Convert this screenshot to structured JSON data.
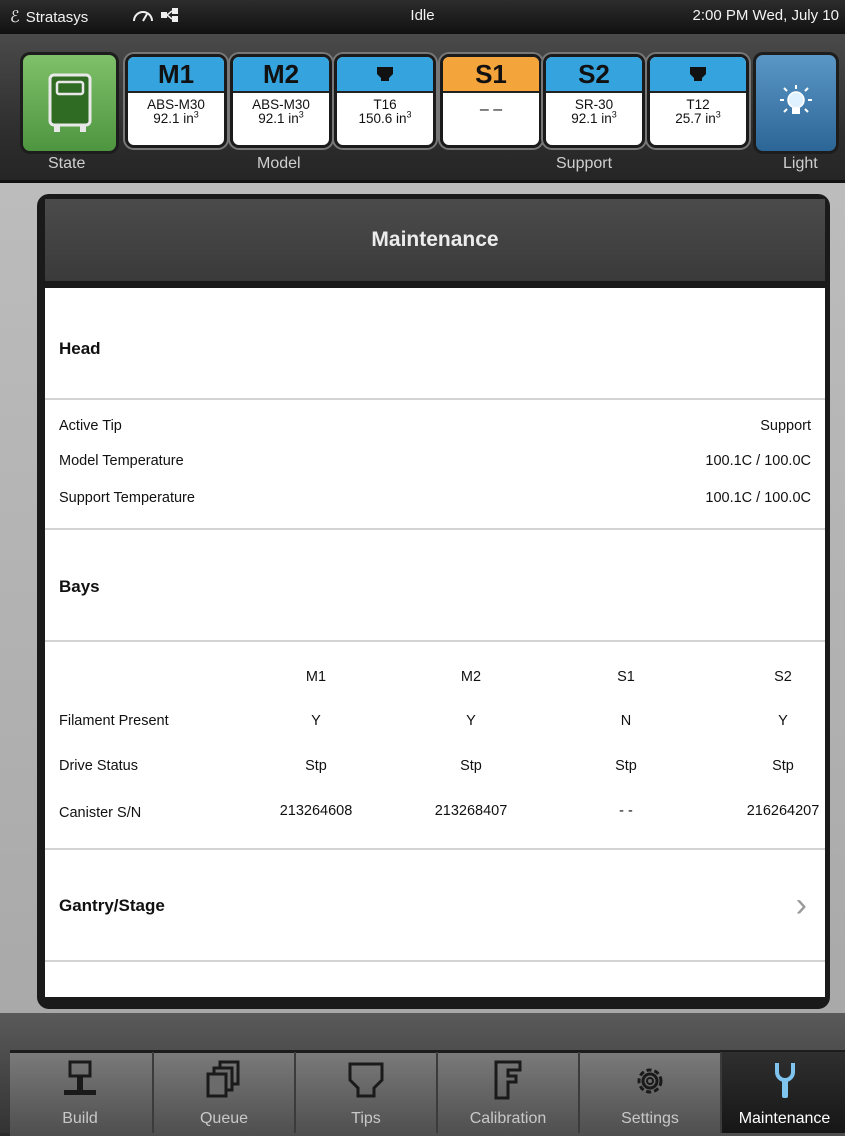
{
  "status_bar": {
    "brand": "Stratasys",
    "state": "Idle",
    "clock": "2:00 PM Wed, July 10"
  },
  "header": {
    "state_label": "State",
    "model_label": "Model",
    "support_label": "Support",
    "light_label": "Light",
    "bays": [
      {
        "id": "M1",
        "line1": "ABS-M30",
        "line2": "92.1 in",
        "sup": "3",
        "color": "#35a3de"
      },
      {
        "id": "M2",
        "line1": "ABS-M30",
        "line2": "92.1 in",
        "sup": "3",
        "color": "#35a3de"
      },
      {
        "id": "tip-model",
        "line1": "T16",
        "line2": "150.6 in",
        "sup": "3",
        "color": "#35a3de",
        "icon": "tip-icon"
      },
      {
        "id": "S1",
        "line1": "– –",
        "line2": "",
        "sup": "",
        "color": "#f3a43a"
      },
      {
        "id": "S2",
        "line1": "SR-30",
        "line2": "92.1 in",
        "sup": "3",
        "color": "#35a3de"
      },
      {
        "id": "tip-support",
        "line1": "T12",
        "line2": "25.7 in",
        "sup": "3",
        "color": "#35a3de",
        "icon": "tip-icon"
      }
    ]
  },
  "page": {
    "title": "Maintenance"
  },
  "head": {
    "title": "Head",
    "rows": [
      {
        "label": "Active Tip",
        "value": "Support"
      },
      {
        "label": "Model Temperature",
        "value": "100.1C / 100.0C"
      },
      {
        "label": "Support Temperature",
        "value": "100.1C / 100.0C"
      }
    ]
  },
  "bays_section": {
    "title": "Bays",
    "columns": [
      "M1",
      "M2",
      "S1",
      "S2"
    ],
    "rows": [
      {
        "label": "Filament Present",
        "values": [
          "Y",
          "Y",
          "N",
          "Y"
        ]
      },
      {
        "label": "Drive Status",
        "values": [
          "Stp",
          "Stp",
          "Stp",
          "Stp"
        ]
      },
      {
        "label": "Canister S/N",
        "values": [
          "213264608",
          "213268407",
          "- -",
          "216264207"
        ]
      }
    ]
  },
  "gantry": {
    "title": "Gantry/Stage"
  },
  "tabs": [
    {
      "label": "Build",
      "icon": "build-icon"
    },
    {
      "label": "Queue",
      "icon": "queue-icon"
    },
    {
      "label": "Tips",
      "icon": "tips-icon"
    },
    {
      "label": "Calibration",
      "icon": "calibration-icon"
    },
    {
      "label": "Settings",
      "icon": "gear-icon"
    },
    {
      "label": "Maintenance",
      "icon": "wrench-icon",
      "active": true
    }
  ]
}
